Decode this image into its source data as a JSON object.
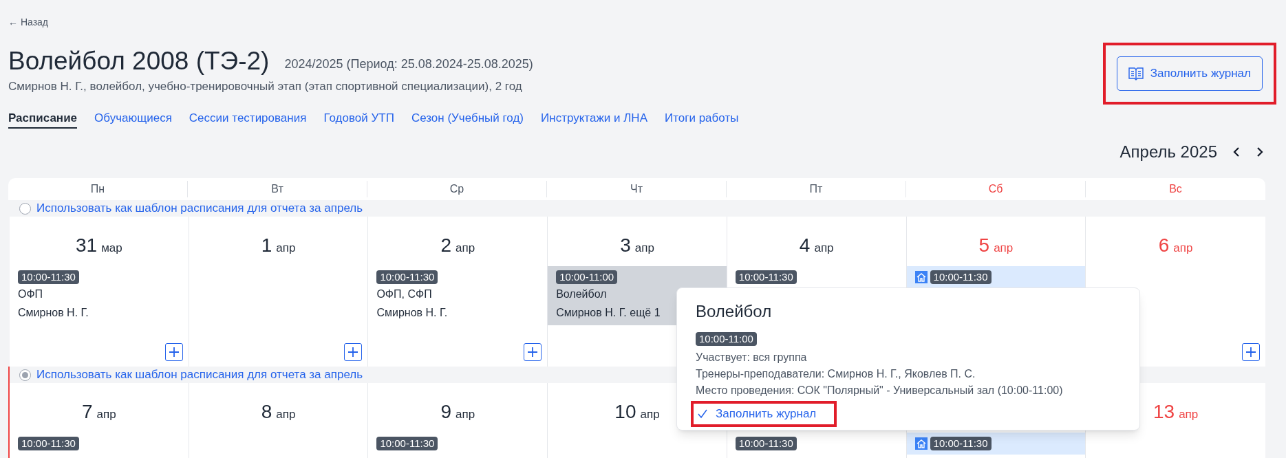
{
  "back_link": "← Назад",
  "title": "Волейбол 2008 (ТЭ-2)",
  "period": "2024/2025 (Период: 25.08.2024-25.08.2025)",
  "subtitle": "Смирнов Н. Г., волейбол, учебно-тренировочный этап (этап спортивной специализации), 2 год",
  "fill_journal_button": {
    "label": "Заполнить журнал",
    "highlighted": true
  },
  "tabs": [
    {
      "label": "Расписание",
      "selected": true
    },
    {
      "label": "Обучающиеся",
      "selected": false
    },
    {
      "label": "Сессии тестирования",
      "selected": false
    },
    {
      "label": "Годовой УТП",
      "selected": false
    },
    {
      "label": "Сезон (Учебный год)",
      "selected": false
    },
    {
      "label": "Инструктажи и ЛНА",
      "selected": false
    },
    {
      "label": "Итоги работы",
      "selected": false
    }
  ],
  "month": "Апрель 2025",
  "weekdays": [
    {
      "label": "Пн",
      "weekend": false
    },
    {
      "label": "Вт",
      "weekend": false
    },
    {
      "label": "Ср",
      "weekend": false
    },
    {
      "label": "Чт",
      "weekend": false
    },
    {
      "label": "Пт",
      "weekend": false
    },
    {
      "label": "Сб",
      "weekend": true
    },
    {
      "label": "Вс",
      "weekend": true
    }
  ],
  "weeks": [
    {
      "template_label": "Использовать как шаблон расписания для отчета за апрель",
      "selected": false,
      "current": false,
      "days": [
        {
          "day": "31",
          "month": "мар",
          "weekend": false,
          "add_button": true,
          "events": [
            {
              "time": "10:00-11:30",
              "title": "ОФП",
              "coach": "Смирнов Н. Г.",
              "selected": false,
              "home": false
            }
          ]
        },
        {
          "day": "1",
          "month": "апр",
          "weekend": false,
          "add_button": true
        },
        {
          "day": "2",
          "month": "апр",
          "weekend": false,
          "add_button": true,
          "events": [
            {
              "time": "10:00-11:30",
              "title": "ОФП, СФП",
              "coach": "Смирнов Н. Г.",
              "selected": false,
              "home": false
            }
          ]
        },
        {
          "day": "3",
          "month": "апр",
          "weekend": false,
          "events": [
            {
              "time": "10:00-11:00",
              "title": "Волейбол",
              "coach": "Смирнов Н. Г. ещё 1",
              "selected": true,
              "home": false
            }
          ]
        },
        {
          "day": "4",
          "month": "апр",
          "weekend": false,
          "events": [
            {
              "time": "10:00-11:30",
              "selected": false,
              "home": false
            }
          ]
        },
        {
          "day": "5",
          "month": "апр",
          "weekend": true,
          "events": [
            {
              "time": "10:00-11:30",
              "selected": false,
              "home": true
            }
          ]
        },
        {
          "day": "6",
          "month": "апр",
          "weekend": true,
          "add_button": true
        }
      ]
    },
    {
      "template_label": "Использовать как шаблон расписания для отчета за апрель",
      "selected": true,
      "current": true,
      "days": [
        {
          "day": "7",
          "month": "апр",
          "weekend": false,
          "events": [
            {
              "time": "10:00-11:30"
            }
          ]
        },
        {
          "day": "8",
          "month": "апр",
          "weekend": false
        },
        {
          "day": "9",
          "month": "апр",
          "weekend": false,
          "events": [
            {
              "time": "10:00-11:30"
            }
          ]
        },
        {
          "day": "10",
          "month": "апр",
          "weekend": false
        },
        {
          "events": [
            {
              "time": "10:00-11:30"
            }
          ]
        },
        {
          "events": [
            {
              "time": "10:00-11:30",
              "home": true
            }
          ]
        },
        {
          "day": "13",
          "month": "апр",
          "weekend": true
        }
      ]
    }
  ],
  "popup": {
    "title": "Волейбол",
    "time": "10:00-11:00",
    "lines": [
      "Участвует: вся группа",
      "Тренеры-преподаватели: Смирнов Н. Г., Яковлев П. С.",
      "Место проведения: СОК \"Полярный\" - Универсальный зал (10:00-11:00)"
    ],
    "action": {
      "label": "Заполнить журнал",
      "highlighted": true
    }
  }
}
